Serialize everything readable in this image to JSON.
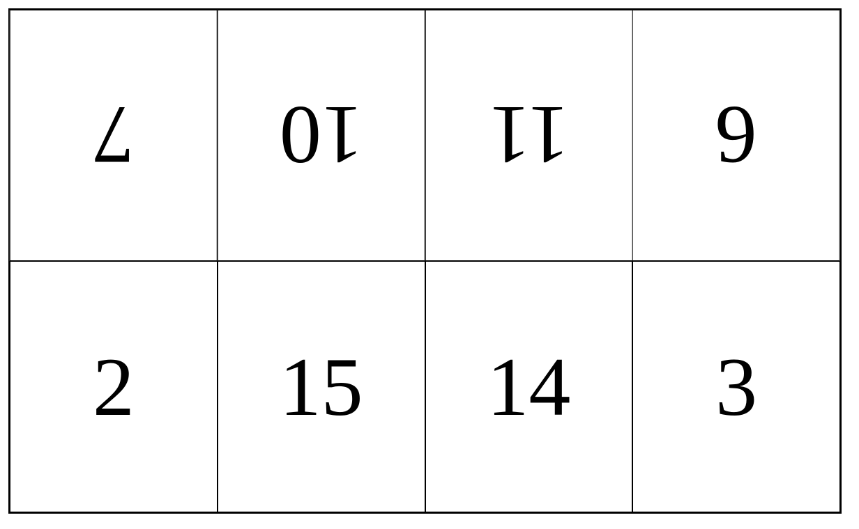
{
  "grid": {
    "rows": [
      {
        "flipped": true,
        "cells": [
          "7",
          "10",
          "11",
          "6"
        ]
      },
      {
        "flipped": false,
        "cells": [
          "2",
          "15",
          "14",
          "3"
        ]
      }
    ]
  }
}
